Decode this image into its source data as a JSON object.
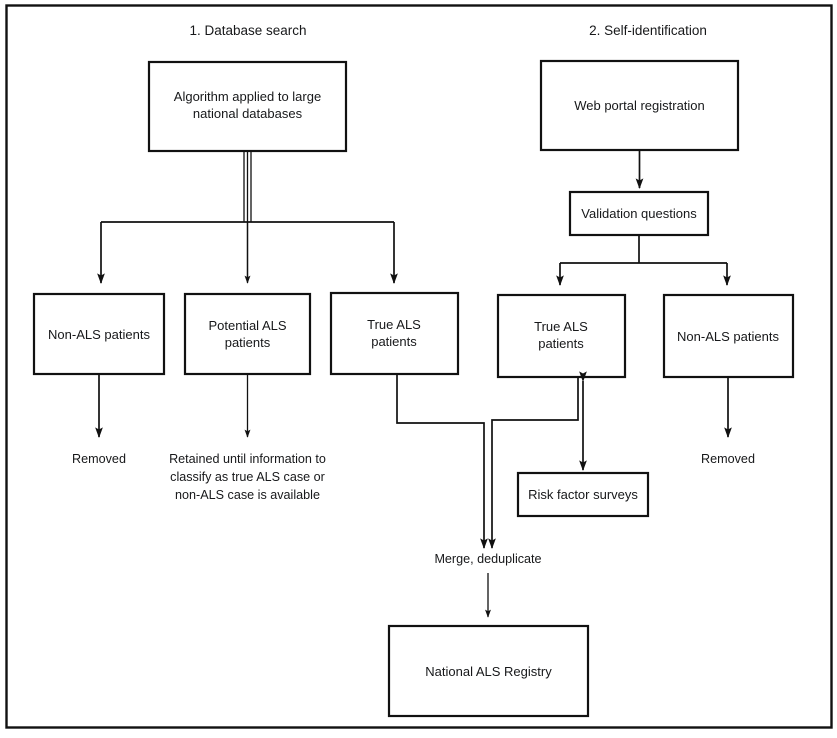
{
  "figure": {
    "type": "flowchart",
    "orientation": "top-to-bottom",
    "background_color": "#ffffff",
    "line_color": "#111111",
    "text_color": "#17181a",
    "has_outer_frame": true
  },
  "sections": [
    {
      "id": "database-search",
      "label": "1. Database search"
    },
    {
      "id": "self-identification",
      "label": "2. Self-identification"
    }
  ],
  "nodes": {
    "algorithm": {
      "label_line1": "Algorithm applied to large",
      "label_line2": "national databases"
    },
    "web_portal": {
      "label": "Web portal registration"
    },
    "validation": {
      "label": "Validation questions"
    },
    "left_non_als": {
      "label": "Non-ALS patients"
    },
    "potential_als": {
      "label_line1": "Potential ALS",
      "label_line2": "patients"
    },
    "left_true_als": {
      "label_line1": "True ALS",
      "label_line2": "patients"
    },
    "right_true_als": {
      "label_line1": "True ALS",
      "label_line2": "patients"
    },
    "right_non_als": {
      "label": "Non-ALS patients"
    },
    "risk_surveys": {
      "label": "Risk factor surveys"
    },
    "registry": {
      "label": "National ALS Registry"
    }
  },
  "annotations": {
    "removed_left": "Removed",
    "removed_right": "Removed",
    "retained_line1": "Retained until information to",
    "retained_line2": "classify as true ALS case or",
    "retained_line3": "non-ALS case is available",
    "merge": "Merge,  deduplicate"
  },
  "edges": [
    {
      "from": "algorithm",
      "to": "left_non_als",
      "arrow": true
    },
    {
      "from": "algorithm",
      "to": "potential_als",
      "arrow": true
    },
    {
      "from": "algorithm",
      "to": "left_true_als",
      "arrow": true
    },
    {
      "from": "web_portal",
      "to": "validation",
      "arrow": true
    },
    {
      "from": "validation",
      "to": "right_true_als",
      "arrow": true
    },
    {
      "from": "validation",
      "to": "right_non_als",
      "arrow": true
    },
    {
      "from": "left_non_als",
      "to": "removed_left",
      "arrow": true
    },
    {
      "from": "potential_als",
      "to": "retained_note",
      "arrow": true
    },
    {
      "from": "right_non_als",
      "to": "removed_right",
      "arrow": true
    },
    {
      "from": "right_true_als",
      "to": "risk_surveys",
      "arrow": "double"
    },
    {
      "from": "left_true_als",
      "to": "merge",
      "arrow": true
    },
    {
      "from": "right_true_als",
      "to": "merge",
      "arrow": true
    },
    {
      "from": "merge",
      "to": "registry",
      "arrow": true
    }
  ]
}
